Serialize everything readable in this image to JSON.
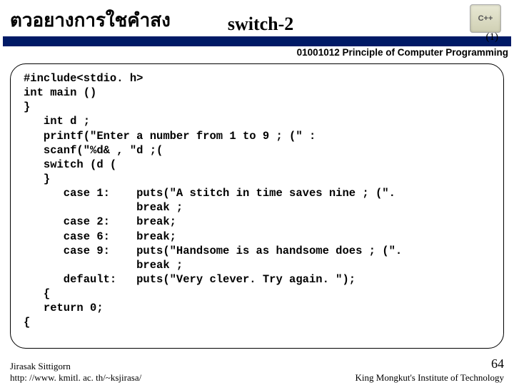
{
  "header": {
    "title_left": "ตวอยางการใชคำสง",
    "title_center": "switch-2",
    "badge": "C++",
    "page_small": "(1)"
  },
  "course_line": "01001012 Principle of Computer Programming",
  "code_lines": [
    "#include<stdio. h>",
    "int main ()",
    "}",
    "   int d ;",
    "   printf(\"Enter a number from 1 to 9 ; (\" :",
    "   scanf(\"%d& , \"d ;(",
    "   switch (d (",
    "   }",
    "      case 1:    puts(\"A stitch in time saves nine ; (\".",
    "                 break ;",
    "      case 2:    break;",
    "      case 6:    break;",
    "      case 9:    puts(\"Handsome is as handsome does ; (\".",
    "                 break ;",
    "      default:   puts(\"Very clever. Try again. \");",
    "   {",
    "   return 0;",
    "{"
  ],
  "footer": {
    "author": "Jirasak Sittigorn",
    "url": "http: //www. kmitl. ac. th/~ksjirasa/",
    "institution": "King Mongkut's Institute of Technology",
    "page_number": "64"
  }
}
